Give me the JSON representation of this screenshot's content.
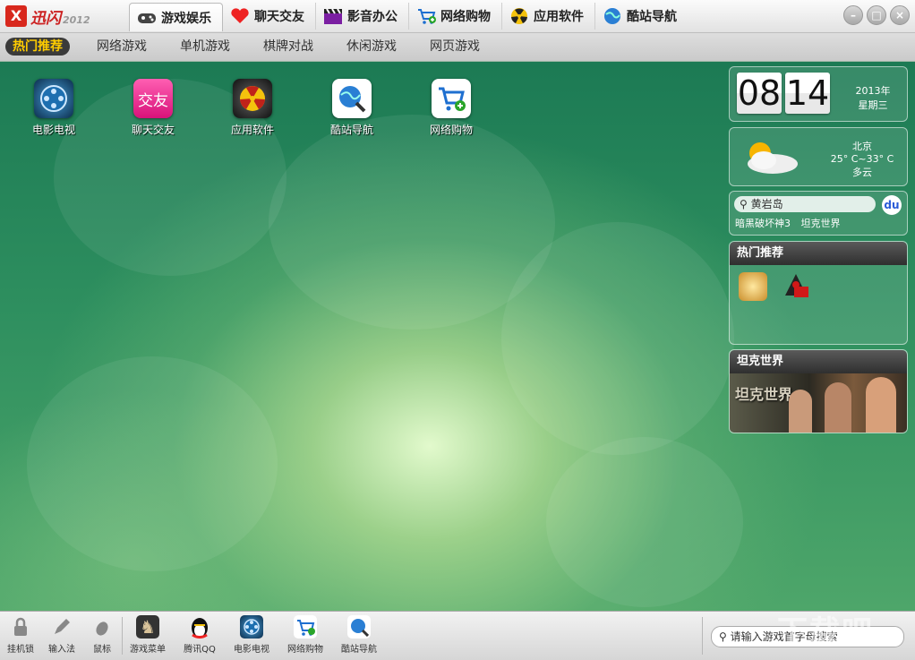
{
  "app": {
    "brand": "迅闪",
    "version": "2012"
  },
  "main_tabs": [
    {
      "label": "游戏娱乐",
      "icon": "gamepad-icon",
      "active": true
    },
    {
      "label": "聊天交友",
      "icon": "heart-icon"
    },
    {
      "label": "影音办公",
      "icon": "clapperboard-icon"
    },
    {
      "label": "网络购物",
      "icon": "shopping-cart-icon"
    },
    {
      "label": "应用软件",
      "icon": "radiation-icon"
    },
    {
      "label": "酷站导航",
      "icon": "globe-icon"
    }
  ],
  "sub_tabs": [
    {
      "label": "热门推荐",
      "active": true
    },
    {
      "label": "网络游戏"
    },
    {
      "label": "单机游戏"
    },
    {
      "label": "棋牌对战"
    },
    {
      "label": "休闲游戏"
    },
    {
      "label": "网页游戏"
    }
  ],
  "desktop_icons": [
    {
      "label": "电影电视",
      "icon": "film-reel-icon"
    },
    {
      "label": "聊天交友",
      "icon": "jiaoyou-icon",
      "glyph": "交友"
    },
    {
      "label": "应用软件",
      "icon": "radiation-icon"
    },
    {
      "label": "酷站导航",
      "icon": "globe-magnifier-icon"
    },
    {
      "label": "网络购物",
      "icon": "shopping-cart-icon"
    }
  ],
  "clock": {
    "hour": "08",
    "minute": "14",
    "year": "2013年",
    "weekday": "星期三"
  },
  "weather": {
    "city": "北京",
    "temp": "25° C~33° C",
    "condition": "多云"
  },
  "search_widget": {
    "query": "黄岩岛",
    "links": [
      "暗黑破坏神3",
      "坦克世界"
    ]
  },
  "hot_panel": {
    "title": "热门推荐"
  },
  "tank_panel": {
    "title": "坦克世界",
    "banner_text": "坦克世界"
  },
  "bottom": {
    "tools": [
      {
        "label": "挂机锁",
        "icon": "lock-icon"
      },
      {
        "label": "输入法",
        "icon": "pen-icon"
      },
      {
        "label": "鼠标",
        "icon": "mouse-icon"
      }
    ],
    "apps": [
      {
        "label": "游戏菜单",
        "icon": "chess-knight-icon"
      },
      {
        "label": "腾讯QQ",
        "icon": "qq-penguin-icon"
      },
      {
        "label": "电影电视",
        "icon": "film-reel-icon"
      },
      {
        "label": "网络购物",
        "icon": "shopping-cart-icon"
      },
      {
        "label": "酷站导航",
        "icon": "globe-magnifier-icon"
      }
    ],
    "search_placeholder": "请输入游戏首字母搜索"
  },
  "watermark": "下载吧"
}
